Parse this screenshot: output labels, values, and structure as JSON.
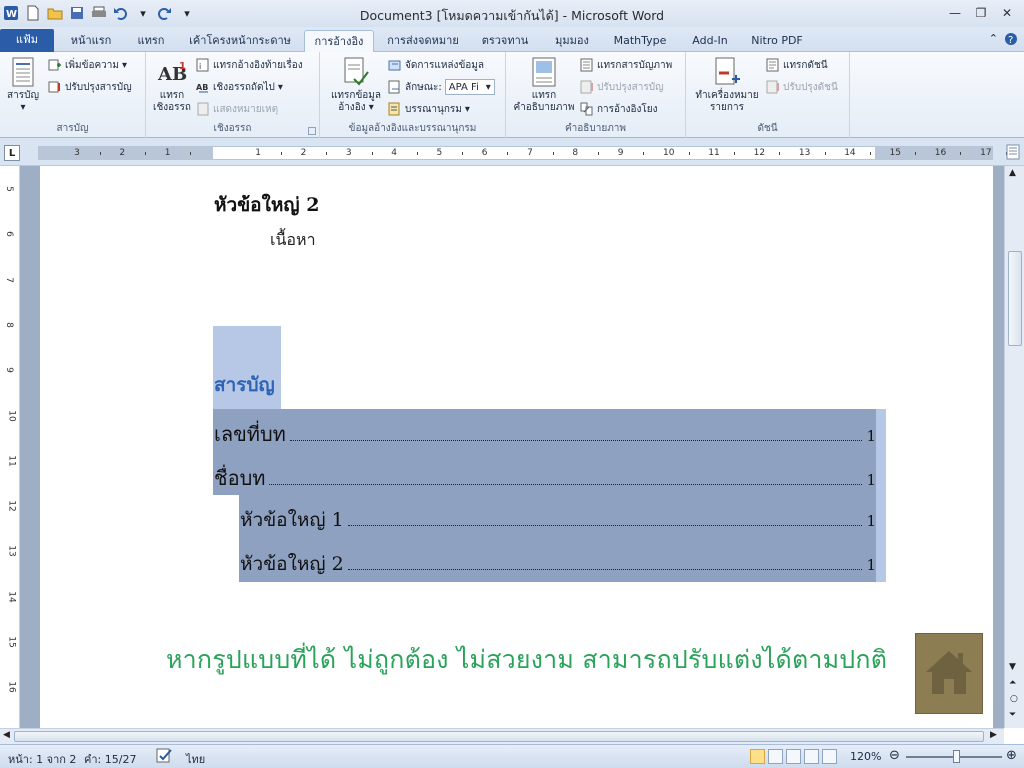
{
  "window": {
    "title": "Document3 [โหมดความเข้ากันได้] - Microsoft Word"
  },
  "tabs": [
    {
      "label": "แฟ้ม"
    },
    {
      "label": "หน้าแรก"
    },
    {
      "label": "แทรก"
    },
    {
      "label": "เค้าโครงหน้ากระดาษ"
    },
    {
      "label": "การอ้างอิง"
    },
    {
      "label": "การส่งจดหมาย"
    },
    {
      "label": "ตรวจทาน"
    },
    {
      "label": "มุมมอง"
    },
    {
      "label": "MathType"
    },
    {
      "label": "Add-In"
    },
    {
      "label": "Nitro PDF"
    }
  ],
  "ribbon": {
    "toc": {
      "group": "สารบัญ",
      "toc_button": "สารบัญ",
      "add_text": "เพิ่มข้อความ",
      "update_table": "ปรับปรุงสารบัญ"
    },
    "footnotes": {
      "group": "เชิงอรรถ",
      "insert_footnote_1": "แทรก",
      "insert_footnote_2": "เชิงอรรถ",
      "insert_endnote": "แทรกอ้างอิงท้ายเรื่อง",
      "next_footnote": "เชิงอรรถถัดไป",
      "show_notes": "แสดงหมายเหตุ"
    },
    "citations": {
      "group": "ข้อมูลอ้างอิงและบรรณานุกรม",
      "insert_citation_1": "แทรกข้อมูล",
      "insert_citation_2": "อ้างอิง",
      "manage_sources": "จัดการแหล่งข้อมูล",
      "style_label": "ลักษณะ:",
      "style_value": "APA Fi",
      "bibliography": "บรรณานุกรม"
    },
    "captions": {
      "group": "คำอธิบายภาพ",
      "insert_caption_1": "แทรก",
      "insert_caption_2": "คำอธิบายภาพ",
      "insert_table_figures": "แทรกสารบัญภาพ",
      "update_table": "ปรับปรุงสารบัญ",
      "cross_reference": "การอ้างอิงโยง"
    },
    "index": {
      "group": "ดัชนี",
      "mark_entry_1": "ทำเครื่องหมาย",
      "mark_entry_2": "รายการ",
      "insert_index": "แทรกดัชนี",
      "update_index": "ปรับปรุงดัชนี"
    }
  },
  "ruler": {
    "h_labels": [
      "3",
      "2",
      "1",
      "1",
      "2",
      "3",
      "4",
      "5",
      "6",
      "7",
      "8",
      "9",
      "10",
      "11",
      "12",
      "13",
      "14",
      "15",
      "16",
      "17"
    ],
    "v_labels": [
      "5",
      "6",
      "7",
      "8",
      "9",
      "10",
      "11",
      "12",
      "13",
      "14",
      "15",
      "16"
    ]
  },
  "document": {
    "heading2": "หัวข้อใหญ่ 2",
    "body_text": "เนื้อหา",
    "toc_heading": "สารบัญ",
    "toc_entries": [
      {
        "text": "เลขที่บท",
        "page": "1"
      },
      {
        "text": "ชื่อบท",
        "page": "1"
      },
      {
        "text": "หัวข้อใหญ่ 1",
        "page": "1"
      },
      {
        "text": "หัวข้อใหญ่ 2",
        "page": "1"
      }
    ],
    "note": "หากรูปแบบที่ได้ ไม่ถูกต้อง ไม่สวยงาม สามารถปรับแต่งได้ตามปกติ"
  },
  "status": {
    "page": "หน้า: 1 จาก 2",
    "words": "คำ: 15/27",
    "language": "ไทย",
    "zoom": "120%"
  },
  "colors": {
    "accent": "#2a5ca8",
    "note": "#2aa35a",
    "selection": "#8ea1c1",
    "toc_heading": "#2e64b5"
  }
}
